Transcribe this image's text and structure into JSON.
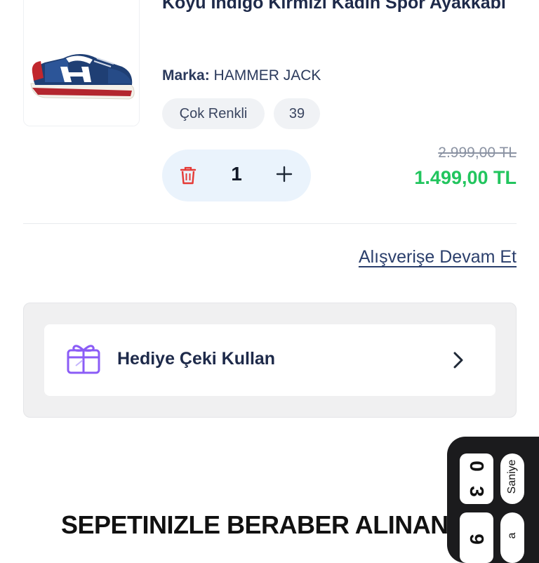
{
  "product": {
    "title": "Koyu İndigo Kırmızı Kadın Spor Ayakkabı",
    "brand_label": "Marka:",
    "brand_value": "HAMMER JACK",
    "chips": [
      "Çok Renkli",
      "39"
    ],
    "quantity": "1",
    "old_price": "2.999,00 TL",
    "new_price": "1.499,00 TL"
  },
  "continue_shopping": "Alışverişe Devam Et",
  "gift": {
    "label": "Hediye Çeki Kullan"
  },
  "section_title": "SEPETINIZLE BERABER ALINAN",
  "timer": {
    "seconds_digits": [
      "3",
      "0"
    ],
    "seconds_label": "Saniye",
    "next_digits": [
      "9",
      ""
    ],
    "next_label": "a"
  },
  "colors": {
    "brand_navy": "#1e2a4a",
    "price_green": "#22c55e",
    "delete_red": "#e53935",
    "gift_purple": "#8b5cf6",
    "qty_bg": "#eaf3fc"
  },
  "icons": [
    "trash-icon",
    "plus-icon",
    "gift-icon",
    "chevron-right-icon"
  ]
}
